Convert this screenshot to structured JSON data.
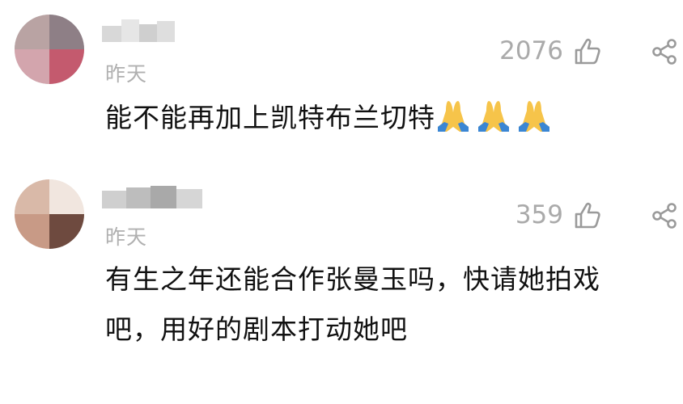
{
  "comments": [
    {
      "time": "昨天",
      "likes": "2076",
      "text": "能不能再加上凯特布兰切特",
      "emoji": [
        "praying-hands",
        "praying-hands",
        "praying-hands"
      ]
    },
    {
      "time": "昨天",
      "likes": "359",
      "text_line1": "有生之年还能合作张曼玉吗，快请她拍戏",
      "text_line2": "吧，用好的剧本打动她吧"
    }
  ],
  "colors": {
    "text": "#111111",
    "meta": "#aaaaaa",
    "icon": "#9a9a9a"
  }
}
